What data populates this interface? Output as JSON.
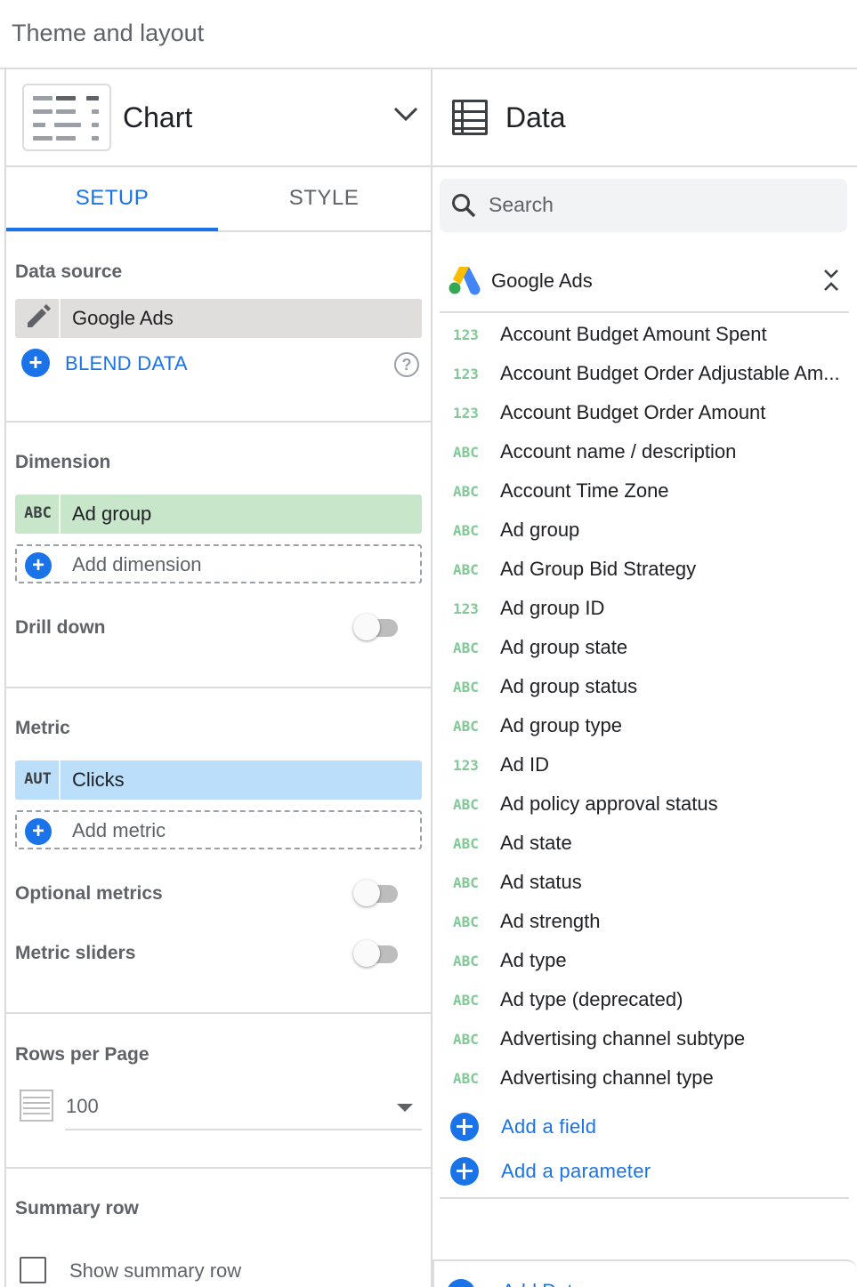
{
  "page": {
    "title": "Theme and layout"
  },
  "chart_panel": {
    "chart_type_label": "Chart",
    "tabs": [
      {
        "label": "SETUP",
        "active": true
      },
      {
        "label": "STYLE",
        "active": false
      }
    ],
    "data_source": {
      "label": "Data source",
      "source_name": "Google Ads",
      "blend_label": "BLEND DATA",
      "help_glyph": "?"
    },
    "dimension": {
      "label": "Dimension",
      "chip": {
        "type": "ABC",
        "name": "Ad group",
        "color": "#c8e6c9"
      },
      "add_label": "Add dimension",
      "drill_down_label": "Drill down",
      "drill_down_on": false
    },
    "metric": {
      "label": "Metric",
      "chip": {
        "type": "AUT",
        "name": "Clicks",
        "color": "#bbdefb"
      },
      "add_label": "Add metric",
      "optional_metrics_label": "Optional metrics",
      "optional_metrics_on": false,
      "metric_sliders_label": "Metric sliders",
      "metric_sliders_on": false
    },
    "rows_per_page": {
      "label": "Rows per Page",
      "value": "100"
    },
    "summary_row": {
      "label": "Summary row",
      "checkbox_label": "Show summary row",
      "checked": false
    }
  },
  "data_panel": {
    "title": "Data",
    "search_placeholder": "Search",
    "source_name": "Google Ads",
    "fields": [
      {
        "type": "123",
        "name": "Account Budget Amount Spent"
      },
      {
        "type": "123",
        "name": "Account Budget Order Adjustable Am..."
      },
      {
        "type": "123",
        "name": "Account Budget Order Amount"
      },
      {
        "type": "ABC",
        "name": "Account name / description"
      },
      {
        "type": "ABC",
        "name": "Account Time Zone"
      },
      {
        "type": "ABC",
        "name": "Ad group"
      },
      {
        "type": "ABC",
        "name": "Ad Group Bid Strategy"
      },
      {
        "type": "123",
        "name": "Ad group ID"
      },
      {
        "type": "ABC",
        "name": "Ad group state"
      },
      {
        "type": "ABC",
        "name": "Ad group status"
      },
      {
        "type": "ABC",
        "name": "Ad group type"
      },
      {
        "type": "123",
        "name": "Ad ID"
      },
      {
        "type": "ABC",
        "name": "Ad policy approval status"
      },
      {
        "type": "ABC",
        "name": "Ad state"
      },
      {
        "type": "ABC",
        "name": "Ad status"
      },
      {
        "type": "ABC",
        "name": "Ad strength"
      },
      {
        "type": "ABC",
        "name": "Ad type"
      },
      {
        "type": "ABC",
        "name": "Ad type (deprecated)"
      },
      {
        "type": "ABC",
        "name": "Advertising channel subtype"
      },
      {
        "type": "ABC",
        "name": "Advertising channel type"
      }
    ],
    "add_field_label": "Add a field",
    "add_parameter_label": "Add a parameter",
    "footer_label": "Add Data"
  },
  "colors": {
    "accent": "#1a73e8",
    "field_type": "#81c995",
    "dimension_chip": "#c8e6c9",
    "metric_chip": "#bbdefb"
  }
}
